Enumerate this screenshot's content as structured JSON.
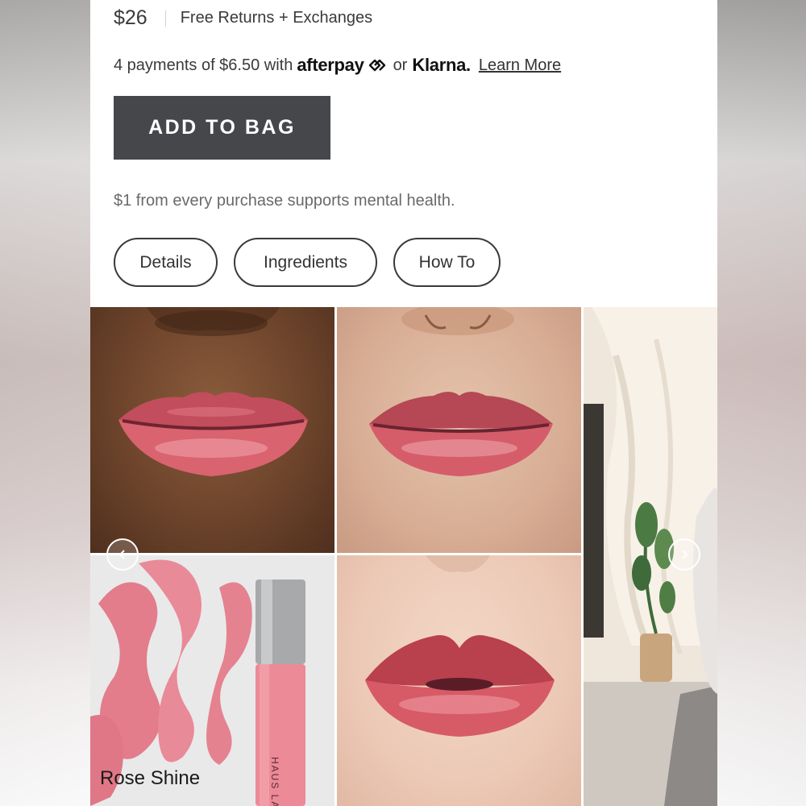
{
  "product": {
    "price": "$26",
    "returns": "Free Returns + Exchanges",
    "payments": {
      "prefix": "4 payments of $6.50 with",
      "afterpay": "afterpay",
      "or": "or",
      "klarna": "Klarna.",
      "learn_more": "Learn More"
    },
    "add_to_bag": "ADD TO BAG",
    "mission": "$1 from every purchase supports mental health."
  },
  "tabs": [
    {
      "label": "Details"
    },
    {
      "label": "Ingredients"
    },
    {
      "label": "How To"
    }
  ],
  "gallery": {
    "shade_label": "Rose Shine",
    "brand_on_tube": "HAUS LABS",
    "prev_icon": "chevron-left-icon",
    "next_icon": "chevron-right-icon"
  },
  "colors": {
    "button_bg": "#46474a",
    "lip_color": "#d95f6b",
    "tube_color": "#ec8a97"
  }
}
